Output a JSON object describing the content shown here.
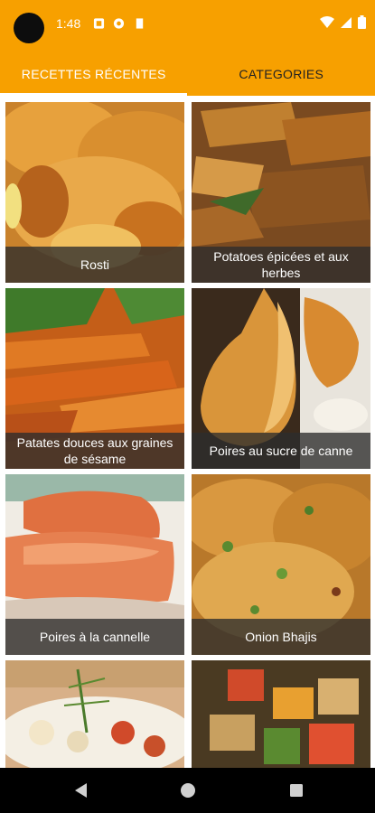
{
  "status_bar": {
    "time": "1:48",
    "background": "#f7a000"
  },
  "tabs": [
    {
      "label": "RECETTES RÉCENTES",
      "active": true
    },
    {
      "label": "CATEGORIES",
      "active": false
    }
  ],
  "recipes": [
    {
      "title": "Rosti"
    },
    {
      "title": "Potatoes épicées et aux herbes"
    },
    {
      "title": "Patates douces aux graines de sésame"
    },
    {
      "title": "Poires au sucre de canne"
    },
    {
      "title": "Poires à la cannelle"
    },
    {
      "title": "Onion Bhajis"
    },
    {
      "title": ""
    },
    {
      "title": ""
    }
  ],
  "nav": {
    "back": "back-icon",
    "home": "home-icon",
    "recents": "recents-icon"
  }
}
